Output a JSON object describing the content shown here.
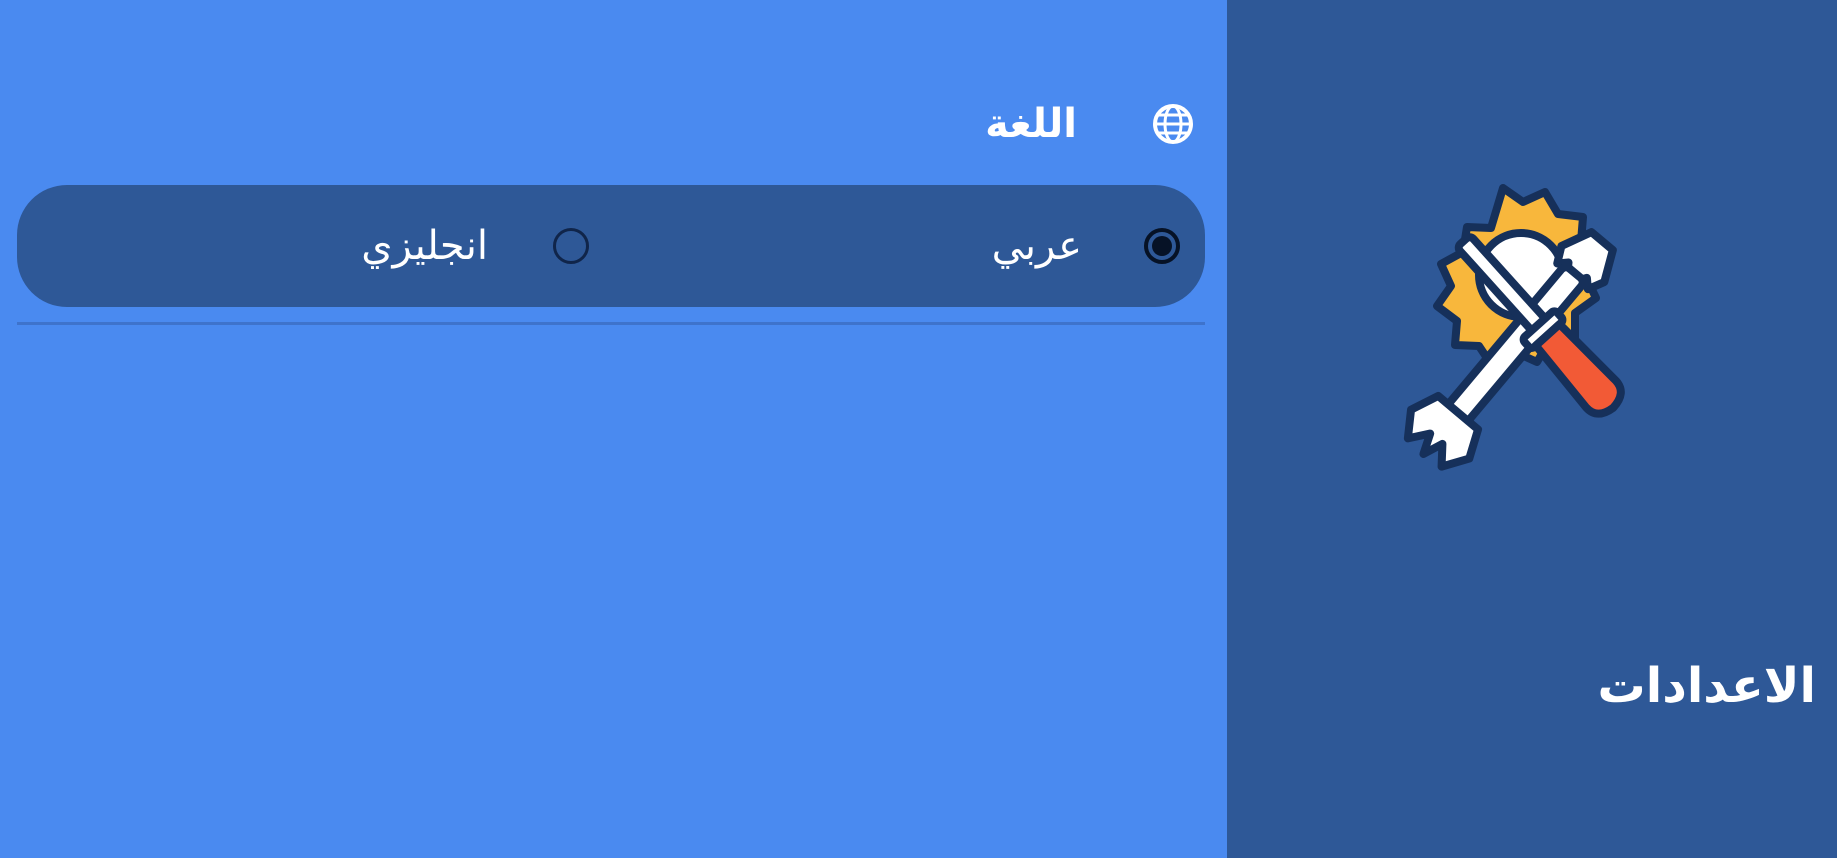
{
  "language_section": {
    "title": "اللغة",
    "icon": "globe-icon",
    "options": [
      {
        "label": "عربي",
        "selected": true
      },
      {
        "label": "انجليزي",
        "selected": false
      }
    ]
  },
  "sidebar": {
    "title": "الاعدادات",
    "illustration": "settings-tools-icon"
  },
  "colors": {
    "main_background": "#4a8af0",
    "panel_background": "#2e5897",
    "gear": "#f8b73c",
    "tool": "#ffffff",
    "handle": "#f25a36",
    "outline": "#16305a"
  }
}
